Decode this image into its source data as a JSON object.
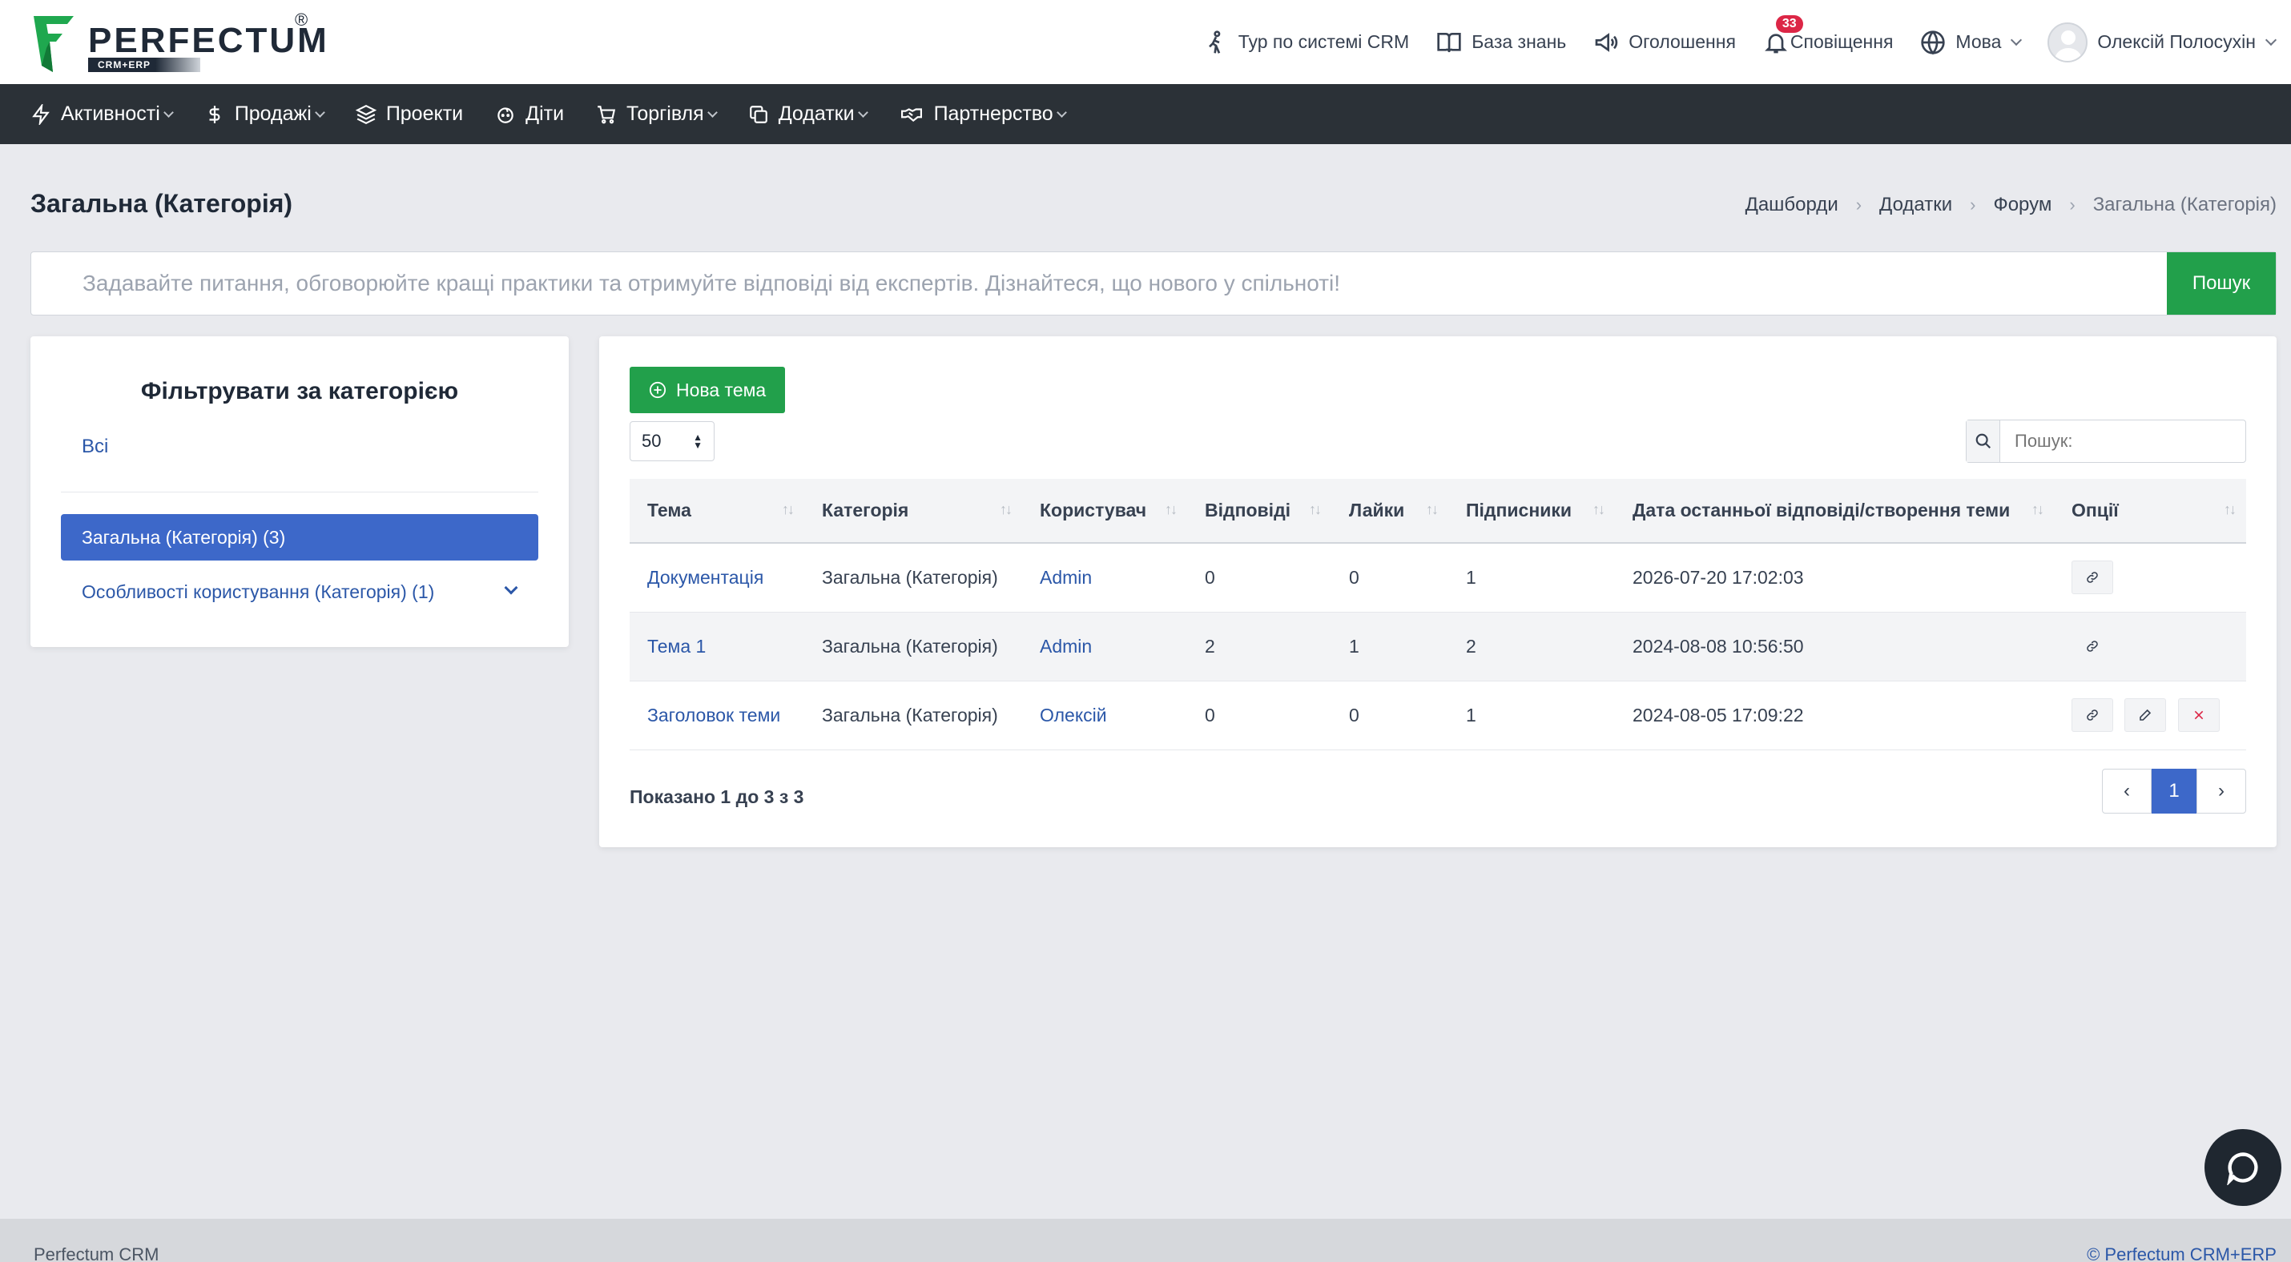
{
  "brand": {
    "name": "PERFECTUM",
    "registered": "®",
    "tagline": "CRM+ERP"
  },
  "header": {
    "tour": "Тур по системі CRM",
    "knowledge": "База знань",
    "announcements": "Оголошення",
    "notifications": "Сповіщення",
    "notifications_count": "33",
    "language": "Мова",
    "user": "Олексій Полосухін"
  },
  "menu": {
    "activities": "Активності",
    "sales": "Продажі",
    "projects": "Проекти",
    "children": "Діти",
    "trade": "Торгівля",
    "addons": "Додатки",
    "partnership": "Партнерство"
  },
  "page": {
    "title": "Загальна (Категорія)"
  },
  "breadcrumb": [
    "Дашборди",
    "Додатки",
    "Форум",
    "Загальна (Категорія)"
  ],
  "hero": {
    "placeholder": "Задавайте питання, обговорюйте кращі практики та отримуйте відповіді від експертів. Дізнайтеся, що нового у спільноті!",
    "button": "Пошук"
  },
  "filter": {
    "title": "Фільтрувати за категорією",
    "all": "Всі",
    "active": "Загальна (Категорія) (3)",
    "other": "Особливості користування (Категорія) (1)"
  },
  "main": {
    "new_topic": "Нова тема",
    "page_length": "50",
    "search_placeholder": "Пошук:",
    "columns": [
      "Тема",
      "Категорія",
      "Користувач",
      "Відповіді",
      "Лайки",
      "Підписники",
      "Дата останньої відповіді/створення теми",
      "Опції"
    ],
    "rows": [
      {
        "topic": "Документація",
        "category": "Загальна (Категорія)",
        "user": "Admin",
        "replies": "0",
        "likes": "0",
        "subscribers": "1",
        "date": "2026-07-20 17:02:03"
      },
      {
        "topic": "Тема 1",
        "category": "Загальна (Категорія)",
        "user": "Admin",
        "replies": "2",
        "likes": "1",
        "subscribers": "2",
        "date": "2024-08-08 10:56:50"
      },
      {
        "topic": "Заголовок теми",
        "category": "Загальна (Категорія)",
        "user": "Олексій",
        "replies": "0",
        "likes": "0",
        "subscribers": "1",
        "date": "2024-08-05 17:09:22"
      }
    ],
    "info": "Показано 1 до 3 з 3",
    "current_page": "1"
  },
  "footer": {
    "left": "Perfectum CRM",
    "right": "© Perfectum CRM+ERP"
  }
}
